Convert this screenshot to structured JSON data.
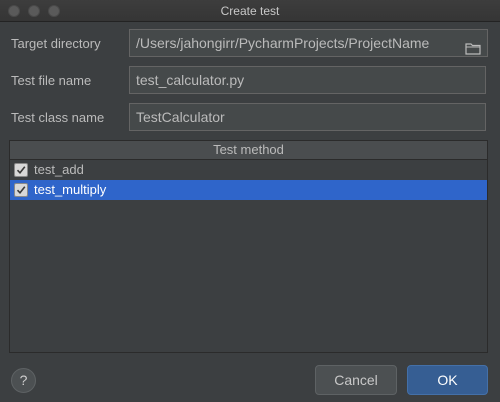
{
  "window": {
    "title": "Create test"
  },
  "form": {
    "target_directory": {
      "label": "Target directory",
      "value": "/Users/jahongirr/PycharmProjects/ProjectName"
    },
    "test_file_name": {
      "label": "Test file name",
      "value": "test_calculator.py"
    },
    "test_class_name": {
      "label": "Test class name",
      "value": "TestCalculator"
    }
  },
  "methods": {
    "header": "Test method",
    "items": [
      {
        "label": "test_add",
        "checked": true,
        "selected": false
      },
      {
        "label": "test_multiply",
        "checked": true,
        "selected": true
      }
    ]
  },
  "footer": {
    "help_label": "?",
    "cancel_label": "Cancel",
    "ok_label": "OK"
  },
  "colors": {
    "background": "#3c3f41",
    "selection": "#2f65ca",
    "ok_button": "#365e93"
  },
  "icons": [
    "folder-icon",
    "checkmark-icon",
    "help-icon"
  ]
}
